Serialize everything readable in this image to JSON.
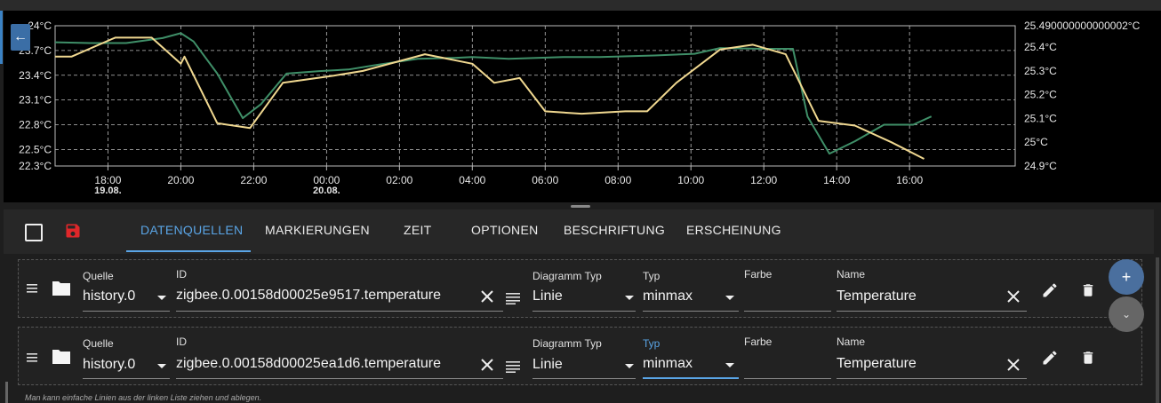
{
  "chart_data": {
    "type": "line",
    "y_left": {
      "ylim": [
        22.3,
        24.0
      ],
      "ticks": [
        22.3,
        22.5,
        22.8,
        23.1,
        23.4,
        23.7,
        24.0
      ],
      "labels": [
        "22.3°C",
        "22.5°C",
        "22.8°C",
        "23.1°C",
        "23.4°C",
        "23.7°C",
        "24°C"
      ]
    },
    "y_right": {
      "ylim": [
        24.9,
        25.49
      ],
      "ticks": [
        24.9,
        25.0,
        25.1,
        25.2,
        25.3,
        25.4,
        25.49
      ],
      "labels": [
        "24.9°C",
        "25°C",
        "25.1°C",
        "25.2°C",
        "25.3°C",
        "25.4°C",
        "25.490000000000002°C"
      ]
    },
    "x_ticks": [
      {
        "t": 18,
        "label": "18:00",
        "date": "19.08."
      },
      {
        "t": 20,
        "label": "20:00",
        "date": ""
      },
      {
        "t": 22,
        "label": "22:00",
        "date": ""
      },
      {
        "t": 24,
        "label": "00:00",
        "date": "20.08."
      },
      {
        "t": 26,
        "label": "02:00",
        "date": ""
      },
      {
        "t": 28,
        "label": "04:00",
        "date": ""
      },
      {
        "t": 30,
        "label": "06:00",
        "date": ""
      },
      {
        "t": 32,
        "label": "08:00",
        "date": ""
      },
      {
        "t": 34,
        "label": "10:00",
        "date": ""
      },
      {
        "t": 36,
        "label": "12:00",
        "date": ""
      },
      {
        "t": 38,
        "label": "14:00",
        "date": ""
      },
      {
        "t": 40,
        "label": "16:00",
        "date": ""
      }
    ],
    "xlim": [
      16.55,
      42.9
    ],
    "series": [
      {
        "axis": "left",
        "color": "#3f8f68",
        "points": [
          [
            16.55,
            23.8
          ],
          [
            17.5,
            23.79
          ],
          [
            18.5,
            23.79
          ],
          [
            19.5,
            23.85
          ],
          [
            20.0,
            23.91
          ],
          [
            20.35,
            23.81
          ],
          [
            21.0,
            23.42
          ],
          [
            21.7,
            22.88
          ],
          [
            22.2,
            23.05
          ],
          [
            22.9,
            23.42
          ],
          [
            23.8,
            23.45
          ],
          [
            24.6,
            23.47
          ],
          [
            25.3,
            23.52
          ],
          [
            26.5,
            23.6
          ],
          [
            27.5,
            23.61
          ],
          [
            28.0,
            23.62
          ],
          [
            29.0,
            23.6
          ],
          [
            30.5,
            23.62
          ],
          [
            31.5,
            23.62
          ],
          [
            33.0,
            23.64
          ],
          [
            34.1,
            23.66
          ],
          [
            34.8,
            23.73
          ],
          [
            36.0,
            23.72
          ],
          [
            36.8,
            23.72
          ],
          [
            37.2,
            22.9
          ],
          [
            37.8,
            22.45
          ],
          [
            38.5,
            22.6
          ],
          [
            39.3,
            22.8
          ],
          [
            40.1,
            22.8
          ],
          [
            40.6,
            22.9
          ]
        ]
      },
      {
        "axis": "right",
        "color": "#f0d890",
        "points": [
          [
            16.55,
            25.36
          ],
          [
            17.0,
            25.36
          ],
          [
            18.2,
            25.44
          ],
          [
            19.2,
            25.44
          ],
          [
            20.0,
            25.33
          ],
          [
            20.1,
            25.36
          ],
          [
            21.0,
            25.08
          ],
          [
            21.9,
            25.06
          ],
          [
            22.8,
            25.25
          ],
          [
            24.2,
            25.28
          ],
          [
            25.0,
            25.3
          ],
          [
            26.7,
            25.37
          ],
          [
            28.0,
            25.33
          ],
          [
            28.6,
            25.25
          ],
          [
            29.3,
            25.27
          ],
          [
            30.0,
            25.13
          ],
          [
            31.0,
            25.12
          ],
          [
            32.2,
            25.13
          ],
          [
            32.8,
            25.13
          ],
          [
            33.6,
            25.25
          ],
          [
            34.8,
            25.39
          ],
          [
            35.7,
            25.41
          ],
          [
            36.6,
            25.37
          ],
          [
            37.5,
            25.09
          ],
          [
            38.5,
            25.07
          ],
          [
            39.5,
            25.0
          ],
          [
            40.4,
            24.93
          ]
        ]
      }
    ]
  },
  "ui": {
    "back_icon": "arrow-left-icon",
    "tabs": [
      "DATENQUELLEN",
      "MARKIERUNGEN",
      "ZEIT",
      "OPTIONEN",
      "BESCHRIFTUNG",
      "ERSCHEINUNG"
    ],
    "active_tab": "DATENQUELLEN",
    "accent": "#5aa5e6",
    "save_color": "#e0272a"
  },
  "labels": {
    "quelle": "Quelle",
    "id": "ID",
    "diagramm_typ": "Diagramm Typ",
    "typ": "Typ",
    "farbe": "Farbe",
    "name": "Name"
  },
  "rows": [
    {
      "quelle": "history.0",
      "id": "zigbee.0.00158d00025e9517.temperature",
      "diagramm_typ": "Linie",
      "typ": "minmax",
      "farbe": "",
      "name": "Temperature"
    },
    {
      "quelle": "history.0",
      "id": "zigbee.0.00158d00025ea1d6.temperature",
      "diagramm_typ": "Linie",
      "typ": "minmax",
      "farbe": "",
      "name": "Temperature"
    }
  ],
  "hint": "Man kann einfache Linien aus der linken Liste ziehen und ablegen."
}
